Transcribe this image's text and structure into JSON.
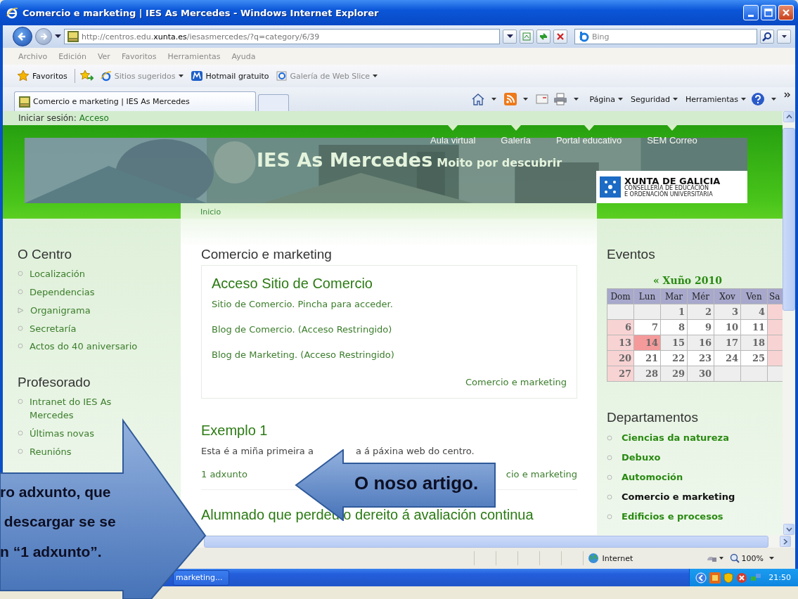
{
  "window": {
    "title": "Comercio e marketing | IES As Mercedes - Windows Internet Explorer"
  },
  "address_bar": {
    "url": "http://centros.edu.**xunta.es**/iesasmercedes/?q=category/6/39",
    "search_placeholder": "Bing"
  },
  "menu": [
    "Archivo",
    "Edición",
    "Ver",
    "Favoritos",
    "Herramientas",
    "Ayuda"
  ],
  "favorites_bar": {
    "favorites": "Favoritos",
    "links": [
      {
        "label": "Sitios sugeridos",
        "disabled": true,
        "dropdown": true
      },
      {
        "label": "Hotmail gratuito",
        "disabled": false,
        "dropdown": false
      },
      {
        "label": "Galería de Web Slice",
        "disabled": true,
        "dropdown": true
      }
    ]
  },
  "tabs": [
    {
      "label": "Comercio e marketing | IES As Mercedes",
      "selected": true
    }
  ],
  "command_bar": [
    "Página",
    "Seguridad",
    "Herramientas"
  ],
  "info_bar": {
    "label": "Iniciar sesión:",
    "link": "Acceso"
  },
  "site": {
    "nav": [
      "Aula virtual",
      "Galería",
      "Portal educativo",
      "SEM Correo"
    ],
    "title": "IES As Mercedes",
    "slogan": "Moito por descubrir",
    "logo": {
      "name": "XUNTA DE GALICIA",
      "line1": "CONSELLERÍA DE EDUCACIÓN",
      "line2": "E ORDENACIÓN UNIVERSITARIA"
    },
    "breadcrumb": "Inicio"
  },
  "left_sidebar": [
    {
      "heading": "O Centro",
      "items": [
        {
          "label": "Localización",
          "kind": "leaf"
        },
        {
          "label": "Dependencias",
          "kind": "leaf"
        },
        {
          "label": "Organigrama",
          "kind": "expandable"
        },
        {
          "label": "Secretaría",
          "kind": "leaf"
        },
        {
          "label": "Actos do 40 aniversario",
          "kind": "leaf"
        }
      ]
    },
    {
      "heading": "Profesorado",
      "items": [
        {
          "label": "Intranet do IES As Mercedes",
          "kind": "leaf"
        },
        {
          "label": "Últimas novas",
          "kind": "leaf"
        },
        {
          "label": "Reunións",
          "kind": "leaf"
        }
      ]
    }
  ],
  "content": {
    "heading": "Comercio e marketing",
    "box": {
      "title": "Acceso Sitio de Comercio",
      "links": [
        "Sitio de Comercio. Pincha para acceder.",
        "Blog de Comercio. (Acceso Restringido)",
        "Blog de Marketing. (Acceso Restringido)"
      ],
      "footer_link": "Comercio e marketing"
    },
    "article": {
      "title": "Exemplo 1",
      "text_parts": [
        "Esta é a miña primeira a",
        "a á páxina web do centro."
      ],
      "attachment_link": "1 adxunto",
      "category_link": "cio e marketing"
    },
    "next_title": "Alumnado que perdeu o dereito á avaliación continua"
  },
  "events": {
    "heading": "Eventos",
    "month": "« Xuño 2010",
    "weekdays": [
      "Dom",
      "Lun",
      "Mar",
      "Mér",
      "Xov",
      "Ven",
      "Sa"
    ],
    "weeks": [
      [
        {
          "kind": "blank"
        },
        {
          "kind": "blank"
        },
        {
          "kind": "day",
          "day": "1"
        },
        {
          "kind": "day",
          "day": "2"
        },
        {
          "kind": "day",
          "day": "3"
        },
        {
          "kind": "day",
          "day": "4"
        },
        {
          "kind": "weekend"
        }
      ],
      [
        {
          "kind": "weekend",
          "day": "6"
        },
        {
          "kind": "day",
          "day": "7"
        },
        {
          "kind": "day",
          "day": "8"
        },
        {
          "kind": "day",
          "day": "9"
        },
        {
          "kind": "day",
          "day": "10"
        },
        {
          "kind": "day",
          "day": "11"
        },
        {
          "kind": "weekend"
        }
      ],
      [
        {
          "kind": "weekend",
          "day": "13"
        },
        {
          "kind": "today",
          "day": "14"
        },
        {
          "kind": "day",
          "day": "15"
        },
        {
          "kind": "day",
          "day": "16"
        },
        {
          "kind": "day",
          "day": "17"
        },
        {
          "kind": "day",
          "day": "18"
        },
        {
          "kind": "weekend"
        }
      ],
      [
        {
          "kind": "weekend",
          "day": "20"
        },
        {
          "kind": "day",
          "day": "21"
        },
        {
          "kind": "day",
          "day": "22"
        },
        {
          "kind": "day",
          "day": "23"
        },
        {
          "kind": "day",
          "day": "24"
        },
        {
          "kind": "day",
          "day": "25"
        },
        {
          "kind": "weekend"
        }
      ],
      [
        {
          "kind": "weekend",
          "day": "27"
        },
        {
          "kind": "day",
          "day": "28"
        },
        {
          "kind": "day",
          "day": "29"
        },
        {
          "kind": "day",
          "day": "30"
        },
        {
          "kind": "blank"
        },
        {
          "kind": "blank"
        },
        {
          "kind": "blank"
        }
      ]
    ]
  },
  "departments": {
    "heading": "Departamentos",
    "items": [
      {
        "label": "Ciencias da natureza",
        "selected": false
      },
      {
        "label": "Debuxo",
        "selected": false
      },
      {
        "label": "Automoción",
        "selected": false
      },
      {
        "label": "Comercio e marketing",
        "selected": true
      },
      {
        "label": "Edificios e procesos",
        "selected": false
      }
    ]
  },
  "status_bar": {
    "zone": "Internet",
    "zoom": "100%"
  },
  "taskbar": {
    "item": "marketing...",
    "time": "21:50"
  },
  "callouts": [
    {
      "kind": "pointing_right",
      "lines": [
        "ro adxunto, que",
        " descargar se se",
        "n “1 adxunto”."
      ]
    },
    {
      "kind": "pointing_left",
      "lines": [
        "O noso artigo."
      ]
    }
  ]
}
